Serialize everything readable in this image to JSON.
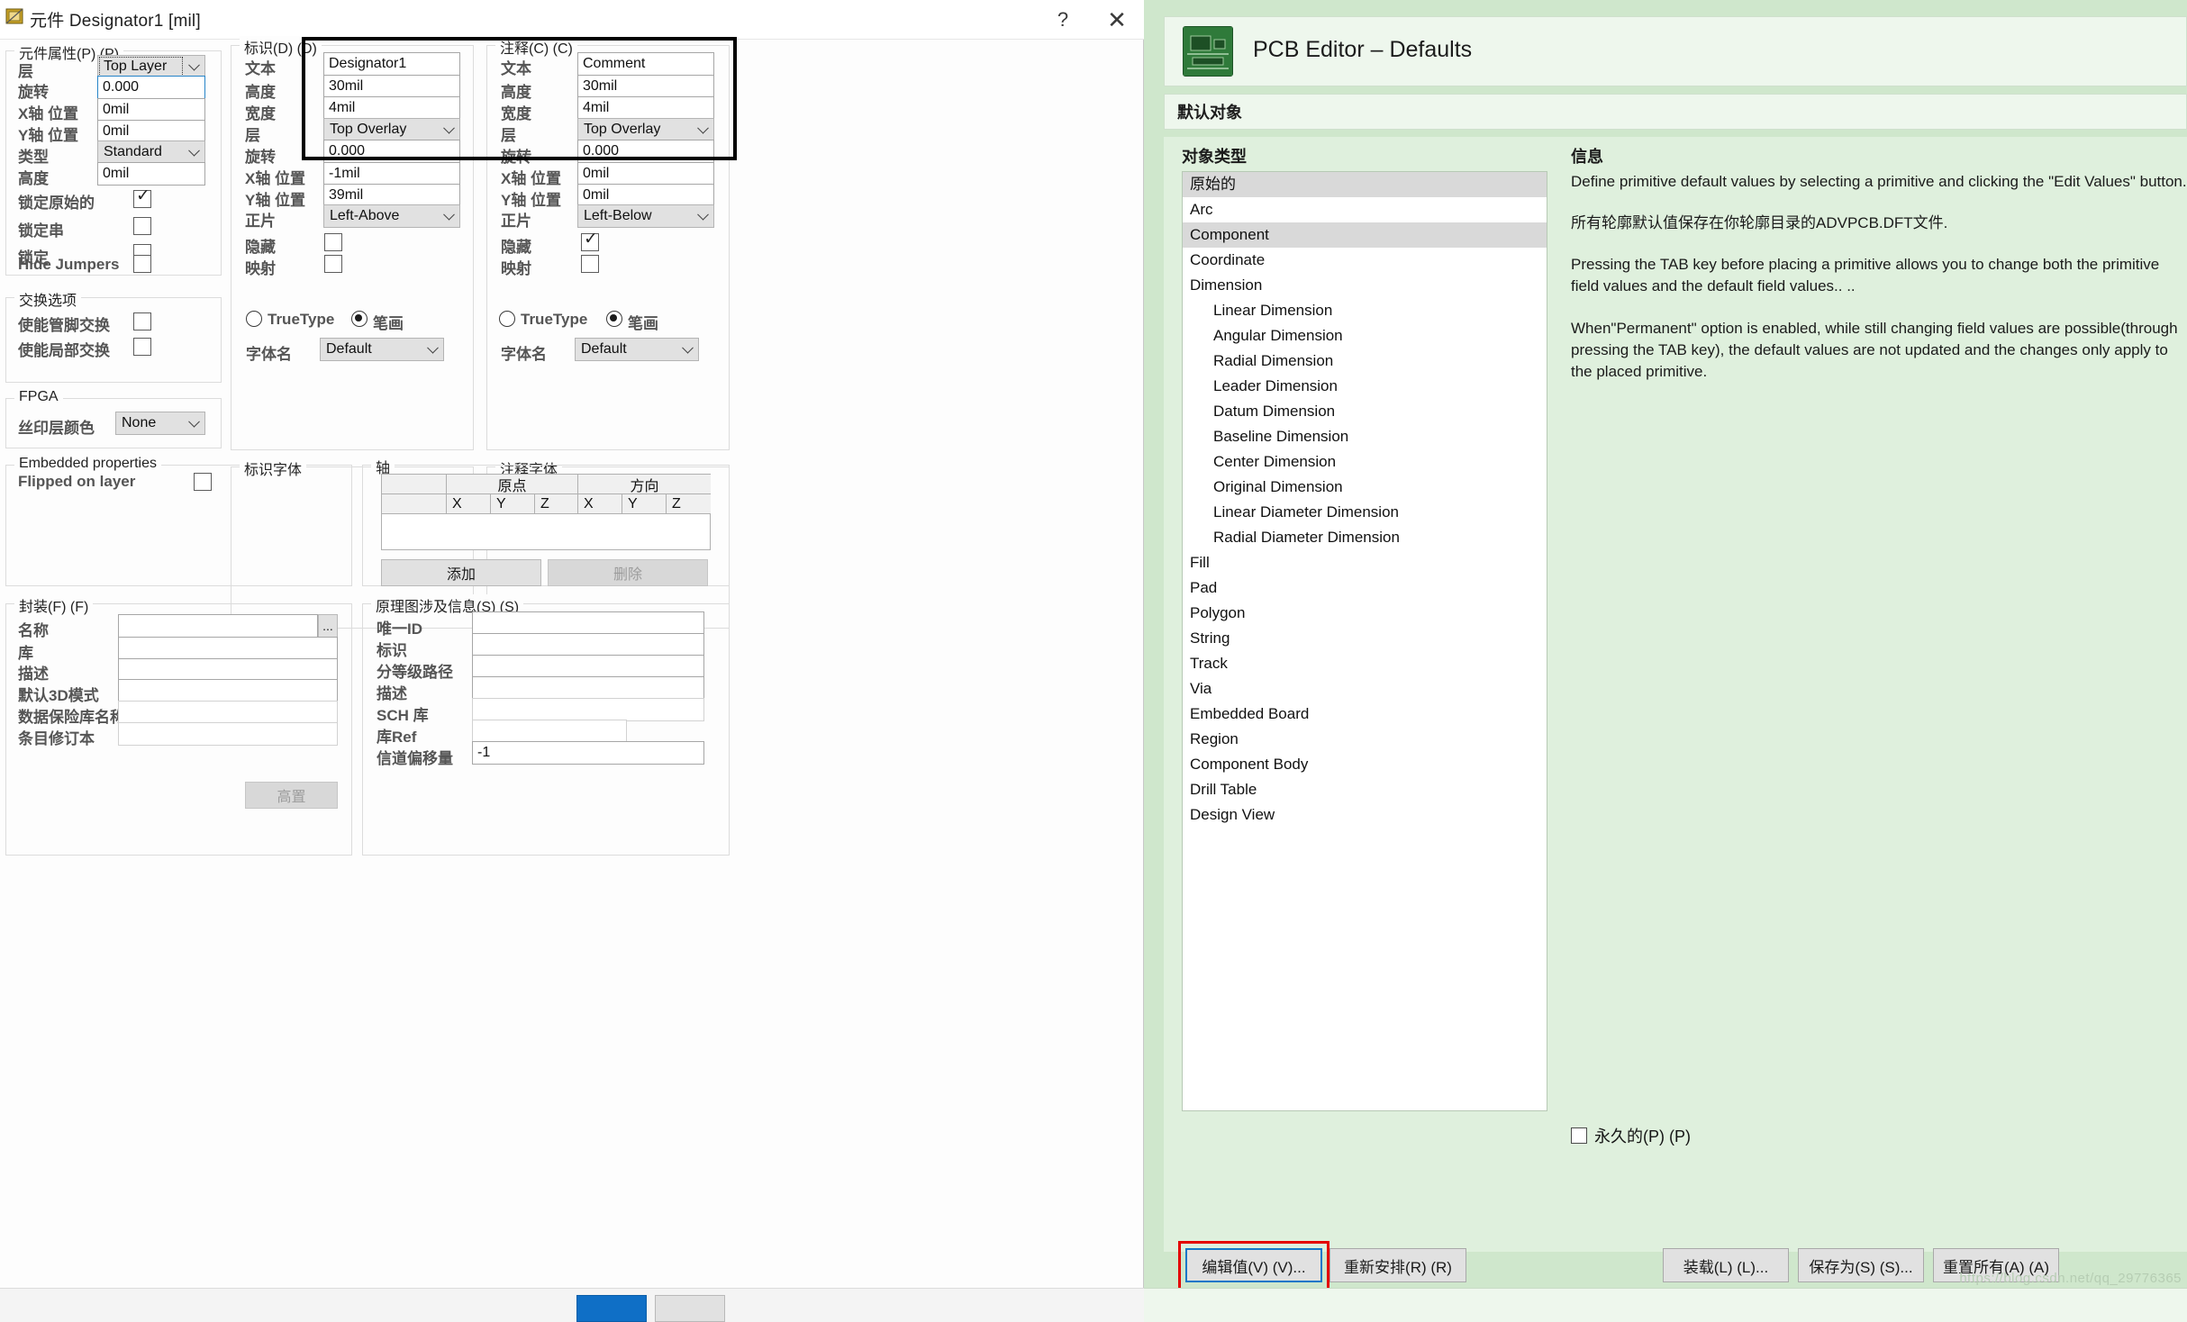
{
  "dialog": {
    "title": "元件 Designator1 [mil]",
    "help_label": "?",
    "close_label": "✕",
    "ok_label": "",
    "cancel_label": ""
  },
  "component_properties": {
    "legend": "元件属性(P) (P)",
    "rows": [
      {
        "label": "层",
        "value": "Top Layer",
        "type": "combo"
      },
      {
        "label": "旋转",
        "value": "0.000",
        "type": "text-focus"
      },
      {
        "label": "X轴 位置",
        "value": "0mil",
        "type": "text"
      },
      {
        "label": "Y轴 位置",
        "value": "0mil",
        "type": "text"
      },
      {
        "label": "类型",
        "value": "Standard",
        "type": "combo"
      },
      {
        "label": "高度",
        "value": "0mil",
        "type": "text"
      }
    ],
    "checks": [
      {
        "label": "锁定原始的",
        "checked": true
      },
      {
        "label": "锁定串",
        "checked": false
      },
      {
        "label": "锁定",
        "checked": false
      },
      {
        "label": "Hide Jumpers",
        "checked": false
      }
    ]
  },
  "swap_options": {
    "legend": "交换选项",
    "checks": [
      {
        "label": "使能管脚交换",
        "checked": false
      },
      {
        "label": "使能局部交换",
        "checked": false
      }
    ]
  },
  "fpga": {
    "legend": "FPGA",
    "label": "丝印层颜色",
    "value": "None"
  },
  "embedded": {
    "legend": "Embedded properties",
    "label": "Flipped on layer",
    "checked": false
  },
  "designator": {
    "legend": "标识(D) (D)",
    "rows": [
      {
        "label": "文本",
        "value": "Designator1",
        "type": "text"
      },
      {
        "label": "高度",
        "value": "30mil",
        "type": "text"
      },
      {
        "label": "宽度",
        "value": "4mil",
        "type": "text"
      },
      {
        "label": "层",
        "value": "Top Overlay",
        "type": "combo"
      },
      {
        "label": "旋转",
        "value": "0.000",
        "type": "text"
      },
      {
        "label": "X轴 位置",
        "value": "-1mil",
        "type": "text"
      },
      {
        "label": "Y轴 位置",
        "value": "39mil",
        "type": "text"
      },
      {
        "label": "正片",
        "value": "Left-Above",
        "type": "combo"
      }
    ],
    "checks": [
      {
        "label": "隐藏",
        "checked": false
      },
      {
        "label": "映射",
        "checked": false
      }
    ]
  },
  "designator_font": {
    "legend": "标识字体",
    "radio_truetype": "TrueType",
    "radio_stroke": "笔画",
    "selected": "笔画",
    "font_name_label": "字体名",
    "font_name_value": "Default"
  },
  "comment": {
    "legend": "注释(C) (C)",
    "rows": [
      {
        "label": "文本",
        "value": "Comment",
        "type": "text"
      },
      {
        "label": "高度",
        "value": "30mil",
        "type": "text"
      },
      {
        "label": "宽度",
        "value": "4mil",
        "type": "text"
      },
      {
        "label": "层",
        "value": "Top Overlay",
        "type": "combo"
      },
      {
        "label": "旋转",
        "value": "0.000",
        "type": "text"
      },
      {
        "label": "X轴 位置",
        "value": "0mil",
        "type": "text"
      },
      {
        "label": "Y轴 位置",
        "value": "0mil",
        "type": "text"
      },
      {
        "label": "正片",
        "value": "Left-Below",
        "type": "combo"
      }
    ],
    "checks": [
      {
        "label": "隐藏",
        "checked": true
      },
      {
        "label": "映射",
        "checked": false
      }
    ]
  },
  "comment_font": {
    "legend": "注释字体",
    "radio_truetype": "TrueType",
    "radio_stroke": "笔画",
    "selected": "笔画",
    "font_name_label": "字体名",
    "font_name_value": "Default"
  },
  "axis": {
    "legend": "轴",
    "group_headers": [
      "",
      "原点",
      "方向"
    ],
    "sub_headers": [
      "",
      "X",
      "Y",
      "Z",
      "X",
      "Y",
      "Z"
    ],
    "rows": [],
    "add_label": "添加",
    "delete_label": "删除"
  },
  "footprint": {
    "legend": "封装(F) (F)",
    "rows": [
      {
        "label": "名称",
        "value": "",
        "disabled": false,
        "browse": "..."
      },
      {
        "label": "库",
        "value": "",
        "disabled": false
      },
      {
        "label": "描述",
        "value": "",
        "disabled": false
      },
      {
        "label": "默认3D模式",
        "value": "",
        "disabled": false
      },
      {
        "label": "数据保险库名称",
        "value": "",
        "disabled": true
      },
      {
        "label": "条目修订本",
        "value": "",
        "disabled": true
      }
    ],
    "action_label": "高置"
  },
  "schematic_ref": {
    "legend": "原理图涉及信息(S) (S)",
    "rows": [
      {
        "label": "唯一ID",
        "value": "",
        "disabled": false
      },
      {
        "label": "标识",
        "value": "",
        "disabled": false
      },
      {
        "label": "分等级路径",
        "value": "",
        "disabled": false
      },
      {
        "label": "描述",
        "value": "",
        "disabled": false
      },
      {
        "label": "SCH 库",
        "value": "",
        "disabled": true
      },
      {
        "label": "库Ref",
        "value": "",
        "disabled": true
      },
      {
        "label": "信道偏移量",
        "value": "-1",
        "disabled": false
      }
    ]
  },
  "right_panel": {
    "title": "PCB Editor – Defaults",
    "section_bar": "默认对象",
    "object_types_header": "对象类型",
    "info_header": "信息",
    "object_types": [
      {
        "label": "原始的",
        "indent": false,
        "selected": true
      },
      {
        "label": "Arc",
        "indent": false,
        "selected": false
      },
      {
        "label": "Component",
        "indent": false,
        "selected": true
      },
      {
        "label": "Coordinate",
        "indent": false,
        "selected": false
      },
      {
        "label": "Dimension",
        "indent": false,
        "selected": false
      },
      {
        "label": "Linear Dimension",
        "indent": true,
        "selected": false
      },
      {
        "label": "Angular Dimension",
        "indent": true,
        "selected": false
      },
      {
        "label": "Radial Dimension",
        "indent": true,
        "selected": false
      },
      {
        "label": "Leader Dimension",
        "indent": true,
        "selected": false
      },
      {
        "label": "Datum Dimension",
        "indent": true,
        "selected": false
      },
      {
        "label": "Baseline Dimension",
        "indent": true,
        "selected": false
      },
      {
        "label": "Center Dimension",
        "indent": true,
        "selected": false
      },
      {
        "label": "Original Dimension",
        "indent": true,
        "selected": false
      },
      {
        "label": "Linear Diameter Dimension",
        "indent": true,
        "selected": false
      },
      {
        "label": "Radial Diameter Dimension",
        "indent": true,
        "selected": false
      },
      {
        "label": "Fill",
        "indent": false,
        "selected": false
      },
      {
        "label": "Pad",
        "indent": false,
        "selected": false
      },
      {
        "label": "Polygon",
        "indent": false,
        "selected": false
      },
      {
        "label": "String",
        "indent": false,
        "selected": false
      },
      {
        "label": "Track",
        "indent": false,
        "selected": false
      },
      {
        "label": "Via",
        "indent": false,
        "selected": false
      },
      {
        "label": "Embedded Board",
        "indent": false,
        "selected": false
      },
      {
        "label": "Region",
        "indent": false,
        "selected": false
      },
      {
        "label": "Component Body",
        "indent": false,
        "selected": false
      },
      {
        "label": "Drill Table",
        "indent": false,
        "selected": false
      },
      {
        "label": "Design View",
        "indent": false,
        "selected": false
      }
    ],
    "info_paragraphs": [
      "Define primitive default values by selecting a primitive and clicking the \"Edit Values\" button.",
      "所有轮廓默认值保存在你轮廓目录的ADVPCB.DFT文件.",
      "Pressing the TAB key before placing a primitive allows you to change both the primitive field values and the default field values.. ..",
      "When\"Permanent\" option is enabled, while still changing field values are possible(through pressing the TAB key), the default values are not updated and the changes only apply to the placed primitive."
    ],
    "permanent_label": "永久的(P) (P)",
    "permanent_checked": false,
    "buttons": {
      "edit_values": "编辑值(V) (V)...",
      "rearrange": "重新安排(R) (R)",
      "load": "装载(L) (L)...",
      "save_as": "保存为(S) (S)...",
      "reset_all": "重置所有(A) (A)"
    },
    "watermark": "https://blog.csdn.net/qq_29776365"
  }
}
